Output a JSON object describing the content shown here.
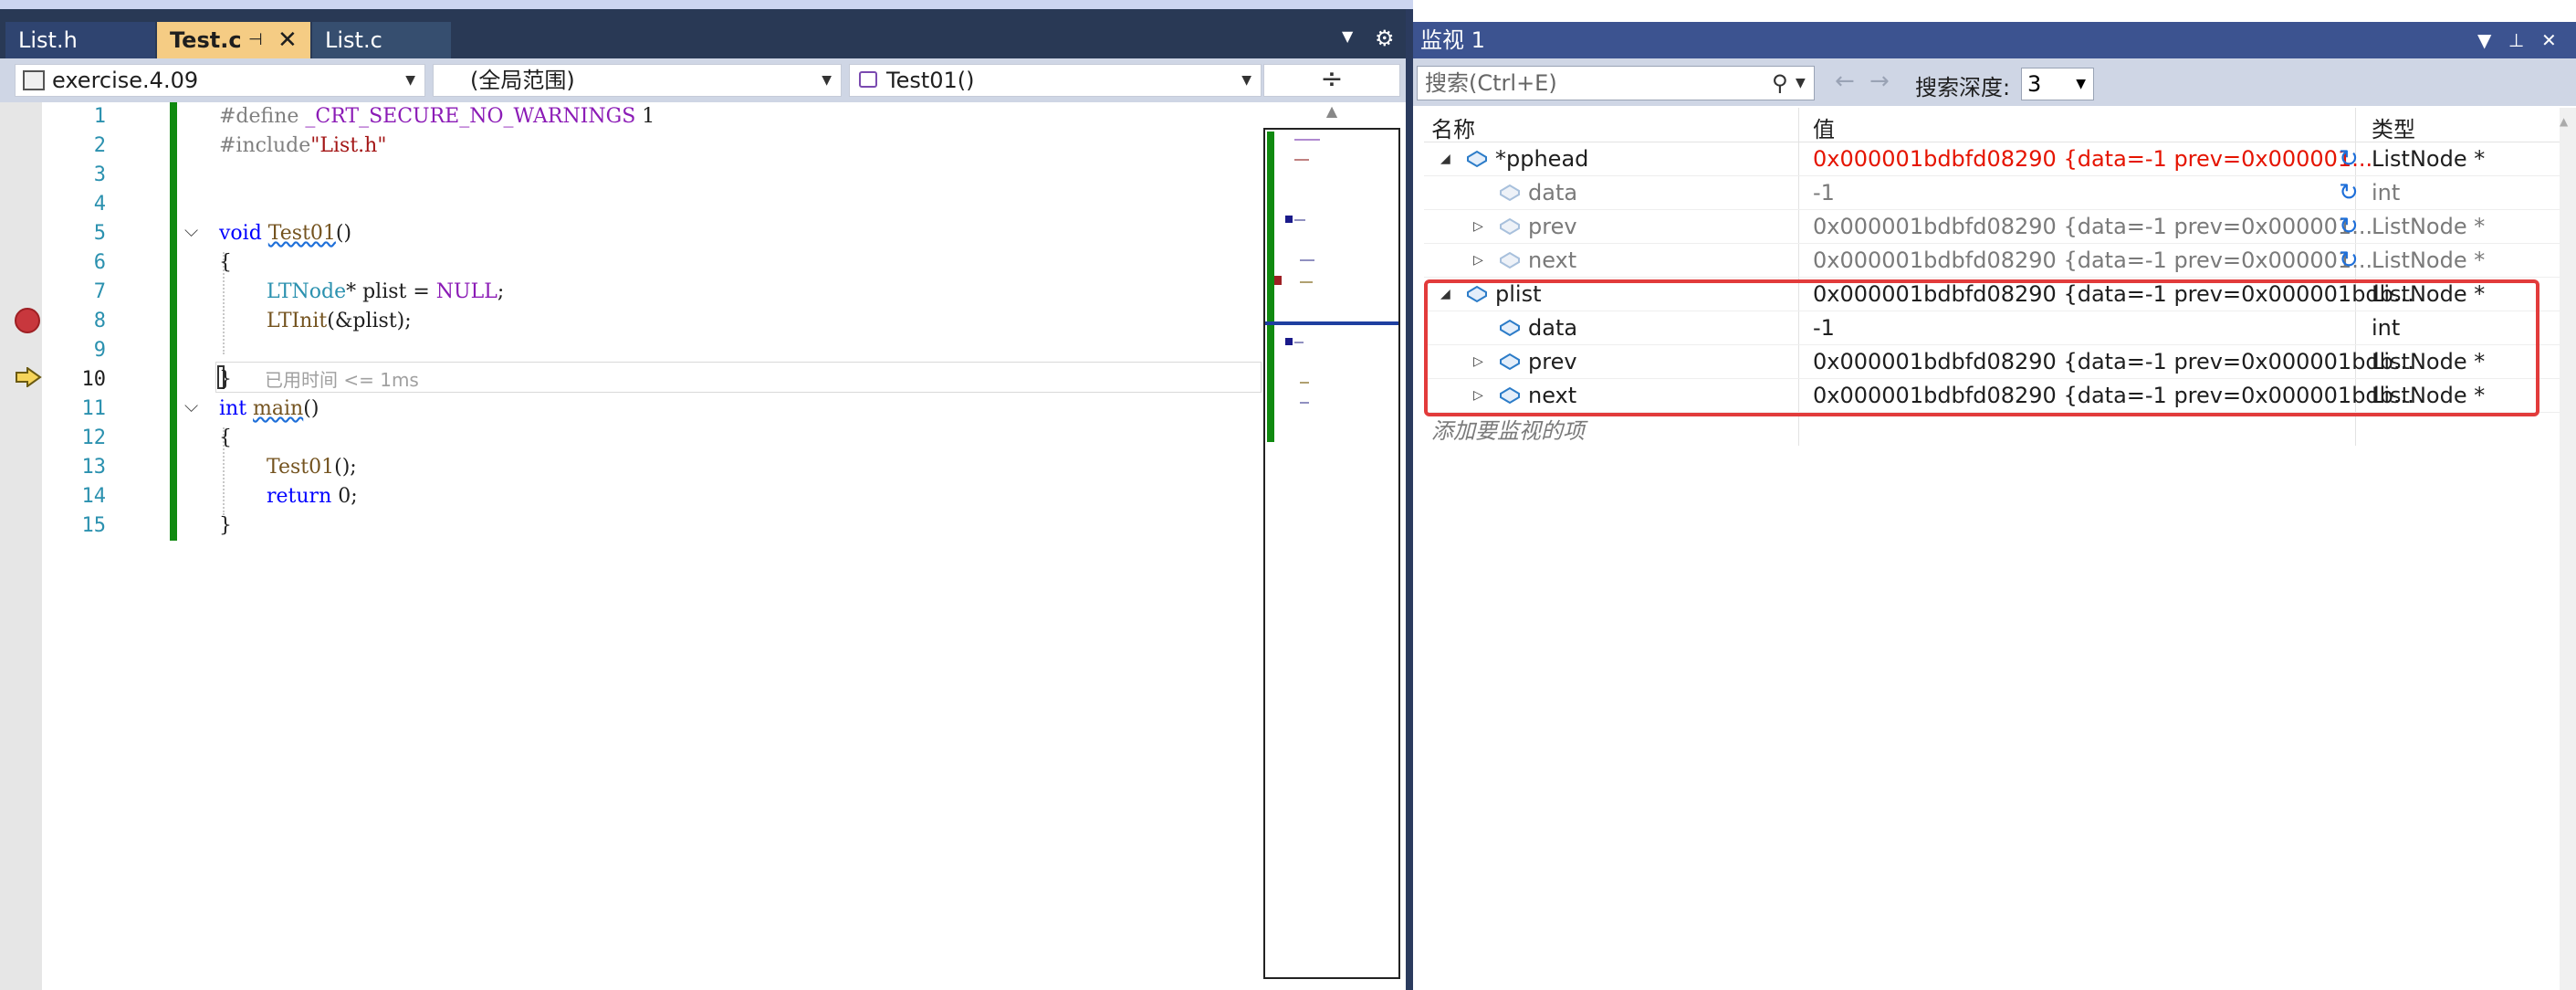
{
  "editor": {
    "tabs": [
      {
        "label": "List.h",
        "active": false
      },
      {
        "label": "Test.c",
        "active": true,
        "pinned": true
      },
      {
        "label": "List.c",
        "active": false
      }
    ],
    "nav": {
      "project": "exercise.4.09",
      "scope": "(全局范围)",
      "function": "Test01()"
    },
    "line_numbers": [
      "1",
      "2",
      "3",
      "4",
      "5",
      "6",
      "7",
      "8",
      "9",
      "10",
      "11",
      "12",
      "13",
      "14",
      "15"
    ],
    "current_line": "10",
    "breakpoint_line": "8",
    "elapsed": "已用时间 <= 1ms",
    "code": {
      "l1_dir": "#define",
      "l1_macro": "_CRT_SECURE_NO_WARNINGS",
      "l1_val": " 1",
      "l2_dir": "#include",
      "l2_str": "\"List.h\"",
      "l5_kw": "void",
      "l5_fn": "Test01",
      "l5_rest": "()",
      "l6": "{",
      "l7_type": "LTNode",
      "l7_mid": "* plist = ",
      "l7_null": "NULL",
      "l7_end": ";",
      "l8_fn": "LTInit",
      "l8_rest": "(&plist);",
      "l10": "}",
      "l11_kw": "int",
      "l11_fn": "main",
      "l11_rest": "()",
      "l12": "{",
      "l13_fn": "Test01",
      "l13_rest": "();",
      "l14_kw": "return",
      "l14_rest": " 0;",
      "l15": "}"
    }
  },
  "watch": {
    "title": "监视 1",
    "search_placeholder": "搜索(Ctrl+E)",
    "depth_label": "搜索深度:",
    "depth_value": "3",
    "columns": {
      "name": "名称",
      "value": "值",
      "type": "类型"
    },
    "rows": [
      {
        "name": "*pphead",
        "value": "0x000001bdbfd08290 {data=-1 prev=0x000001...",
        "type": "ListNode *",
        "state": "changed"
      },
      {
        "name": "data",
        "value": "-1",
        "type": "int",
        "state": "stale"
      },
      {
        "name": "prev",
        "value": "0x000001bdbfd08290 {data=-1 prev=0x000001...",
        "type": "ListNode *",
        "state": "stale"
      },
      {
        "name": "next",
        "value": "0x000001bdbfd08290 {data=-1 prev=0x000001...",
        "type": "ListNode *",
        "state": "stale"
      },
      {
        "name": "plist",
        "value": "0x000001bdbfd08290 {data=-1 prev=0x000001bdb...",
        "type": "ListNode *",
        "state": "normal"
      },
      {
        "name": "data",
        "value": "-1",
        "type": "int",
        "state": "normal"
      },
      {
        "name": "prev",
        "value": "0x000001bdbfd08290 {data=-1 prev=0x000001bdb...",
        "type": "ListNode *",
        "state": "normal"
      },
      {
        "name": "next",
        "value": "0x000001bdbfd08290 {data=-1 prev=0x000001bdb...",
        "type": "ListNode *",
        "state": "normal"
      }
    ],
    "add_watch_hint": "添加要监视的项"
  },
  "colors": {
    "changed_value": "#e51400",
    "highlight_box": "#e23b3b",
    "breakpoint": "#c8373d"
  }
}
